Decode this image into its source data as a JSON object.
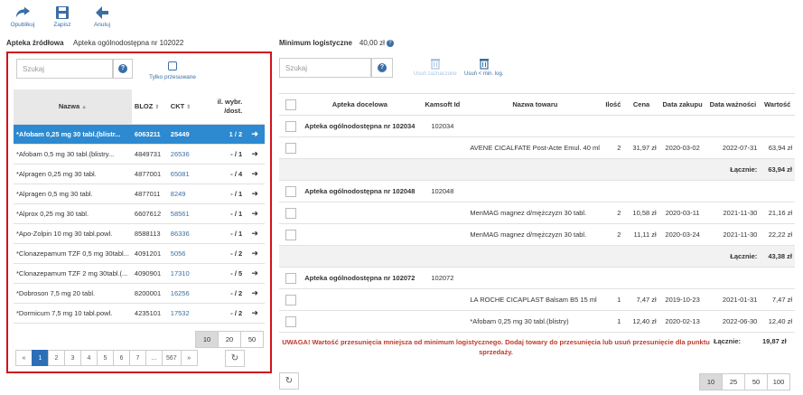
{
  "toolbar": {
    "publish": "Opublikuj",
    "save": "Zapisz",
    "cancel": "Anuluj"
  },
  "source": {
    "label": "Apteka źródłowa",
    "value": "Apteka ogólnodostępna nr 102022"
  },
  "minlog": {
    "label": "Minimum logistyczne",
    "value": "40,00 zł",
    "help": "?"
  },
  "left": {
    "search_placeholder": "Szukaj",
    "help": "?",
    "only_moved_label": "Tylko przesuwane",
    "headers": {
      "name": "Nazwa",
      "bloz": "BLOZ",
      "ckt": "CKT",
      "il_line1": "il. wybr.",
      "il_line2": "/dost."
    },
    "rows": [
      {
        "name": "*Afobam 0,25 mg 30 tabl.(blistr...",
        "bloz": "6063211",
        "ckt": "25449",
        "il": "1 / 2",
        "selected": true
      },
      {
        "name": "*Afobam 0,5 mg 30 tabl.(blistry...",
        "bloz": "4849731",
        "ckt": "26536",
        "il": "- / 1"
      },
      {
        "name": "*Alpragen 0,25 mg 30 tabl.",
        "bloz": "4877001",
        "ckt": "65081",
        "il": "- / 4"
      },
      {
        "name": "*Alpragen 0,5 mg 30 tabl.",
        "bloz": "4877011",
        "ckt": "8249",
        "il": "- / 1"
      },
      {
        "name": "*Alprox 0,25 mg 30 tabl.",
        "bloz": "6607612",
        "ckt": "58561",
        "il": "- / 1"
      },
      {
        "name": "*Apo-Zolpin 10 mg 30 tabl.powl.",
        "bloz": "8588113",
        "ckt": "86336",
        "il": "- / 1"
      },
      {
        "name": "*Clonazepamum TZF 0,5 mg 30tabl...",
        "bloz": "4091201",
        "ckt": "5056",
        "il": "- / 2"
      },
      {
        "name": "*Clonazepamum TZF 2 mg 30tabl.(...",
        "bloz": "4090901",
        "ckt": "17310",
        "il": "- / 5"
      },
      {
        "name": "*Dobroson 7,5 mg 20 tabl.",
        "bloz": "8200001",
        "ckt": "16256",
        "il": "- / 2"
      },
      {
        "name": "*Dormicum 7,5 mg 10 tabl.powl.",
        "bloz": "4235101",
        "ckt": "17532",
        "il": "- / 2"
      }
    ],
    "page_sizes": [
      "10",
      "20",
      "50"
    ],
    "pager": [
      "«",
      "1",
      "2",
      "3",
      "4",
      "5",
      "6",
      "7",
      "...",
      "567",
      "»"
    ]
  },
  "right": {
    "search_placeholder": "Szukaj",
    "help": "?",
    "remove_selected": "Usuń zaznaczone",
    "remove_min": "Usuń < min. log.",
    "headers": {
      "pharmacy": "Apteka docelowa",
      "kamsoft": "Kamsoft Id",
      "product": "Nazwa towaru",
      "qty": "Ilość",
      "price": "Cena",
      "date_buy": "Data zakupu",
      "date_exp": "Data ważności",
      "value": "Wartość"
    },
    "groups": [
      {
        "pharmacy": "Apteka ogólnodostępna nr 102034",
        "kamsoft": "102034",
        "items": [
          {
            "product": "AVENE CICALFATE Post-Acte Emul. 40 ml",
            "qty": "2",
            "price": "31,97 zł",
            "date_buy": "2020-03-02",
            "date_exp": "2022-07-31",
            "value": "63,94 zł"
          }
        ],
        "total_label": "Łącznie:",
        "total": "63,94 zł"
      },
      {
        "pharmacy": "Apteka ogólnodostępna nr 102048",
        "kamsoft": "102048",
        "items": [
          {
            "product": "MenMAG magnez d/mężczyzn 30 tabl.",
            "qty": "2",
            "price": "10,58 zł",
            "date_buy": "2020-03-11",
            "date_exp": "2021-11-30",
            "value": "21,16 zł"
          },
          {
            "product": "MenMAG magnez d/mężczyzn 30 tabl.",
            "qty": "2",
            "price": "11,11 zł",
            "date_buy": "2020-03-24",
            "date_exp": "2021-11-30",
            "value": "22,22 zł"
          }
        ],
        "total_label": "Łącznie:",
        "total": "43,38 zł"
      },
      {
        "pharmacy": "Apteka ogólnodostępna nr 102072",
        "kamsoft": "102072",
        "items": [
          {
            "product": "LA ROCHE CICAPLAST Balsam B5 15 ml",
            "qty": "1",
            "price": "7,47 zł",
            "date_buy": "2019-10-23",
            "date_exp": "2021-01-31",
            "value": "7,47 zł"
          },
          {
            "product": "*Afobam 0,25 mg 30 tabl.(blistry)",
            "qty": "1",
            "price": "12,40 zł",
            "date_buy": "2020-02-13",
            "date_exp": "2022-06-30",
            "value": "12,40 zł"
          }
        ],
        "total_label": "Łącznie:",
        "total": "19,87 zł"
      }
    ],
    "warning": "UWAGA! Wartość przesunięcia mniejsza od minimum logistycznego. Dodaj towary do przesunięcia lub usuń przesunięcie dla punktu sprzedaży.",
    "page_sizes": [
      "10",
      "25",
      "50",
      "100"
    ]
  },
  "colors": {
    "accent": "#3a6ea5",
    "selected_row": "#2d8ad0",
    "highlight_border": "#d0121b",
    "warning": "#c0392b"
  }
}
